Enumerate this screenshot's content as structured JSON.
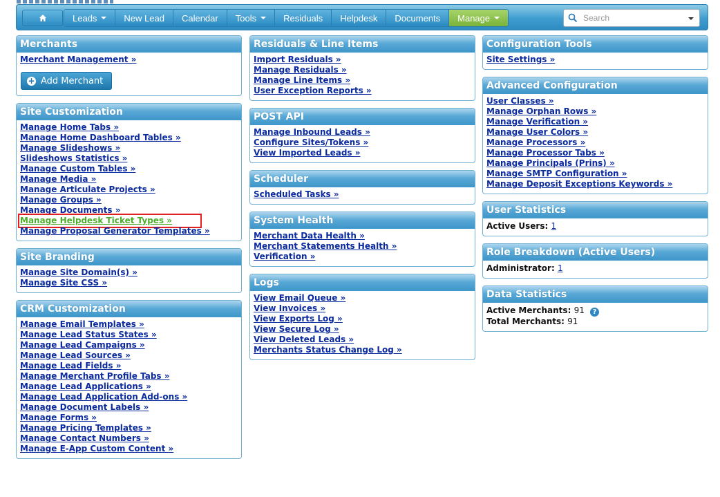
{
  "nav": {
    "home_icon": "home-icon",
    "items": [
      {
        "label": "Leads",
        "dropdown": true
      },
      {
        "label": "New Lead",
        "dropdown": false
      },
      {
        "label": "Calendar",
        "dropdown": false
      },
      {
        "label": "Tools",
        "dropdown": true
      },
      {
        "label": "Residuals",
        "dropdown": false
      },
      {
        "label": "Helpdesk",
        "dropdown": false
      },
      {
        "label": "Documents",
        "dropdown": false
      },
      {
        "label": "Manage",
        "dropdown": true,
        "active": true
      }
    ],
    "search_placeholder": "Search",
    "active_color": "#8cc152",
    "bar_color": "#3f9dd0"
  },
  "merchants": {
    "title": "Merchants",
    "links": [
      "Merchant Management »"
    ],
    "add_button": "Add Merchant"
  },
  "site_customization": {
    "title": "Site Customization",
    "links": [
      "Manage Home Tabs »",
      "Manage Home Dashboard Tables »",
      "Manage Slideshows »",
      "Slideshows Statistics »",
      "Manage Custom Tables »",
      "Manage Media »",
      "Manage Articulate Projects »",
      "Manage Groups »",
      "Manage Documents »",
      "Manage Helpdesk Ticket Types »",
      "Manage Proposal Generator Templates »"
    ]
  },
  "site_branding": {
    "title": "Site Branding",
    "links": [
      "Manage Site Domain(s) »",
      "Manage Site CSS »"
    ]
  },
  "crm_customization": {
    "title": "CRM Customization",
    "links": [
      "Manage Email Templates »",
      "Manage Lead Status States »",
      "Manage Lead Campaigns »",
      "Manage Lead Sources »",
      "Manage Lead Fields »",
      "Manage Merchant Profile Tabs »",
      "Manage Lead Applications »",
      "Manage Lead Application Add-ons »",
      "Manage Document Labels »",
      "Manage Forms »",
      "Manage Pricing Templates »",
      "Manage Contact Numbers »",
      "Manage E-App Custom Content »"
    ]
  },
  "residuals": {
    "title": "Residuals & Line Items",
    "links": [
      "Import Residuals »",
      "Manage Residuals »",
      "Manage Line Items »",
      "User Exception Reports »"
    ]
  },
  "post_api": {
    "title": "POST API",
    "links": [
      "Manage Inbound Leads »",
      "Configure Sites/Tokens »",
      "View Imported Leads »"
    ]
  },
  "scheduler": {
    "title": "Scheduler",
    "links": [
      "Scheduled Tasks »"
    ]
  },
  "system_health": {
    "title": "System Health",
    "links": [
      "Merchant Data Health »",
      "Merchant Statements Health »",
      "Verification »"
    ]
  },
  "logs": {
    "title": "Logs",
    "links": [
      "View Email Queue »",
      "View Invoices »",
      "View Exports Log »",
      "View Secure Log »",
      "View Deleted Leads »",
      "Merchants Status Change Log »"
    ]
  },
  "configuration_tools": {
    "title": "Configuration Tools",
    "links": [
      "Site Settings »"
    ]
  },
  "advanced_configuration": {
    "title": "Advanced Configuration",
    "links": [
      "User Classes »",
      "Manage Orphan Rows »",
      "Manage Verification »",
      "Manage User Colors »",
      "Manage Processors »",
      "Manage Processor Tabs »",
      "Manage Principals (Prins) »",
      "Manage SMTP Configuration »",
      "Manage Deposit Exceptions Keywords »"
    ]
  },
  "user_statistics": {
    "title": "User Statistics",
    "label": "Active Users:",
    "value": "1"
  },
  "role_breakdown": {
    "title": "Role Breakdown (Active Users)",
    "label": "Administrator:",
    "value": "1"
  },
  "data_statistics": {
    "title": "Data Statistics",
    "active_label": "Active Merchants:",
    "active_value": "91",
    "total_label": "Total Merchants:",
    "total_value": "91",
    "help_icon": "help-icon"
  },
  "colors": {
    "link": "#0b2b9e",
    "highlight_link": "#4caf2a",
    "highlight_box": "#e02020",
    "panel_border": "#6fb0d3"
  }
}
